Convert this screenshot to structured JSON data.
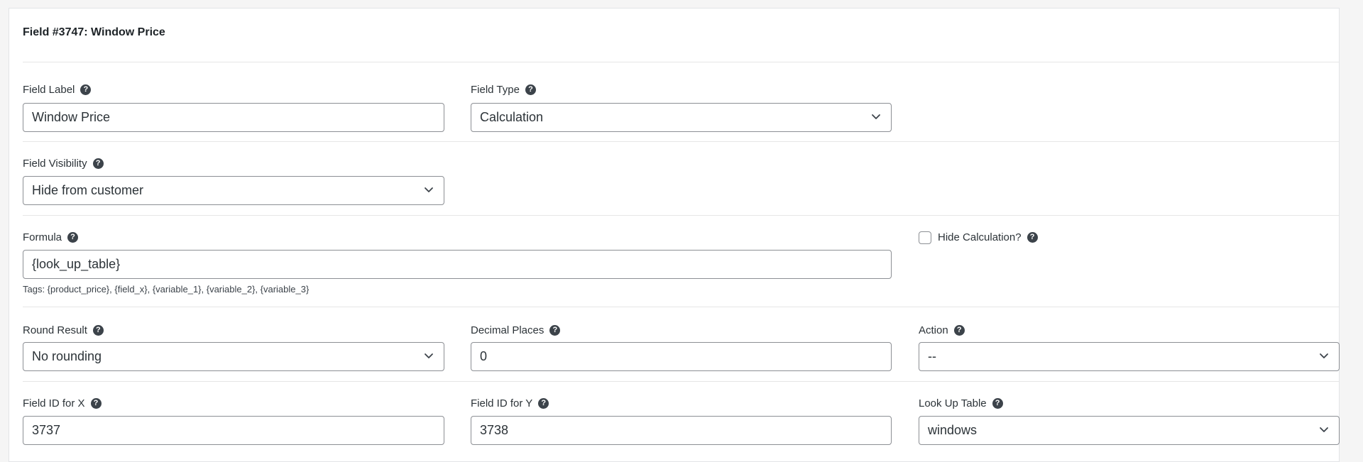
{
  "title": "Field #3747: Window Price",
  "fields": {
    "field_label": {
      "label": "Field Label",
      "value": "Window Price"
    },
    "field_type": {
      "label": "Field Type",
      "value": "Calculation"
    },
    "field_visibility": {
      "label": "Field Visibility",
      "value": "Hide from customer"
    },
    "formula": {
      "label": "Formula",
      "value": "{look_up_table}"
    },
    "formula_tags": "Tags: {product_price}, {field_x}, {variable_1}, {variable_2}, {variable_3}",
    "hide_calculation": {
      "label": "Hide Calculation?",
      "checked": false
    },
    "round_result": {
      "label": "Round Result",
      "value": "No rounding"
    },
    "decimal_places": {
      "label": "Decimal Places",
      "value": "0"
    },
    "action": {
      "label": "Action",
      "value": "--"
    },
    "field_id_x": {
      "label": "Field ID for X",
      "value": "3737"
    },
    "field_id_y": {
      "label": "Field ID for Y",
      "value": "3738"
    },
    "look_up_table": {
      "label": "Look Up Table",
      "value": "windows"
    }
  },
  "icons": {
    "help": "question-circle-icon",
    "chevron": "chevron-down-icon"
  },
  "colors": {
    "border": "#8c8f94",
    "help_icon_bg": "#3c434a",
    "text": "#2c3338"
  }
}
